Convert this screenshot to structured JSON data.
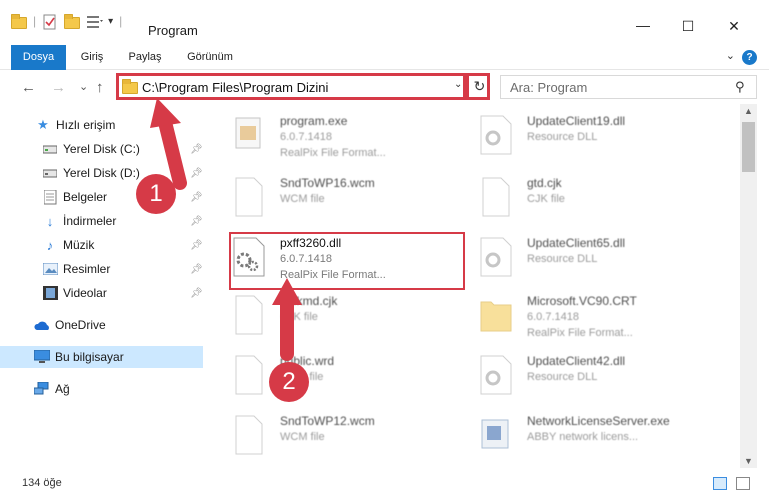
{
  "window": {
    "title": "Program",
    "minimize_glyph": "—",
    "maximize_glyph": "☐",
    "close_glyph": "✕"
  },
  "ribbon": {
    "tabs": [
      {
        "label": "Dosya"
      },
      {
        "label": "Giriş"
      },
      {
        "label": "Paylaş"
      },
      {
        "label": "Görünüm"
      }
    ],
    "help_glyph": "?"
  },
  "nav": {
    "back_glyph": "←",
    "forward_glyph": "→",
    "recent_glyph": "⌄",
    "up_glyph": "↑",
    "address": "C:\\Program Files\\Program Dizini",
    "search_placeholder": "Ara: Program"
  },
  "sidebar": {
    "items": [
      {
        "label": "Hızlı erişim",
        "icon": "star-icon"
      },
      {
        "label": "Yerel Disk (C:)",
        "icon": "drive-icon",
        "pinned": true
      },
      {
        "label": "Yerel Disk (D:)",
        "icon": "drive-icon",
        "pinned": true
      },
      {
        "label": "Belgeler",
        "icon": "documents-icon",
        "pinned": true
      },
      {
        "label": "İndirmeler",
        "icon": "download-icon",
        "pinned": true
      },
      {
        "label": "Müzik",
        "icon": "music-icon",
        "pinned": true
      },
      {
        "label": "Resimler",
        "icon": "pictures-icon",
        "pinned": true
      },
      {
        "label": "Videolar",
        "icon": "videos-icon",
        "pinned": true
      },
      {
        "label": "OneDrive",
        "icon": "cloud-icon"
      },
      {
        "label": "Bu bilgisayar",
        "icon": "computer-icon",
        "selected": true
      },
      {
        "label": "Ağ",
        "icon": "network-icon"
      }
    ]
  },
  "files": [
    {
      "name": "program.exe",
      "line1": "6.0.7.1418",
      "line2": "RealPix File Format...",
      "icon": "exe-icon"
    },
    {
      "name": "UpdateClient19.dll",
      "line1": "Resource DLL",
      "line2": "",
      "icon": "dll-icon"
    },
    {
      "name": "SndToWP16.wcm",
      "line1": "WCM file",
      "line2": "",
      "icon": "file-icon"
    },
    {
      "name": "gtd.cjk",
      "line1": "CJK file",
      "line2": "",
      "icon": "file-icon"
    },
    {
      "name": "pxff3260.dll",
      "line1": "6.0.7.1418",
      "line2": "RealPix File Format...",
      "icon": "dll-icon",
      "highlighted": true
    },
    {
      "name": "UpdateClient65.dll",
      "line1": "Resource DLL",
      "line2": "",
      "icon": "dll-icon"
    },
    {
      "name": "gbfkmd.cjk",
      "line1": "CJK file",
      "line2": "",
      "icon": "file-icon"
    },
    {
      "name": "Microsoft.VC90.CRT",
      "line1": "6.0.7.1418",
      "line2": "RealPix File Format...",
      "icon": "folder-icon"
    },
    {
      "name": "public.wrd",
      "line1": "WRD file",
      "line2": "",
      "icon": "file-icon"
    },
    {
      "name": "UpdateClient42.dll",
      "line1": "Resource DLL",
      "line2": "",
      "icon": "dll-icon"
    },
    {
      "name": "SndToWP12.wcm",
      "line1": "WCM file",
      "line2": "",
      "icon": "file-icon"
    },
    {
      "name": "NetworkLicenseServer.exe",
      "line1": "ABBY network licens...",
      "line2": "",
      "icon": "app-icon"
    }
  ],
  "status": {
    "item_count": "134 öğe"
  },
  "annotations": {
    "step1": "1",
    "step2": "2",
    "color": "#d63a47"
  }
}
